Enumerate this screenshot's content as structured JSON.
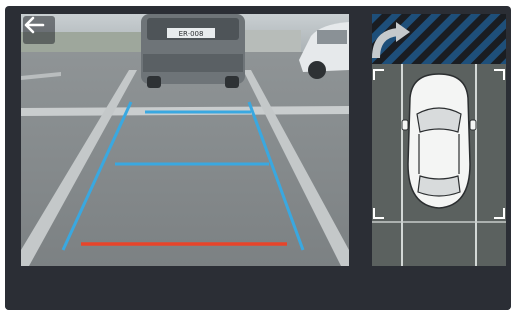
{
  "app": {
    "view": "rear-camera-parking-assist"
  },
  "icons": {
    "back": "left-arrow-icon",
    "camera_mode": "curved-arrow-icon",
    "vehicle": "car-top-view-icon"
  },
  "camera": {
    "rear_car_plate": "ER·008"
  },
  "colors": {
    "screen_bg": "#2b2e35",
    "guide_line": "#3aa8e0",
    "stop_line": "#e8442a",
    "hatch_blue": "#1e4f7a",
    "hatch_dark": "#1a1d22"
  }
}
